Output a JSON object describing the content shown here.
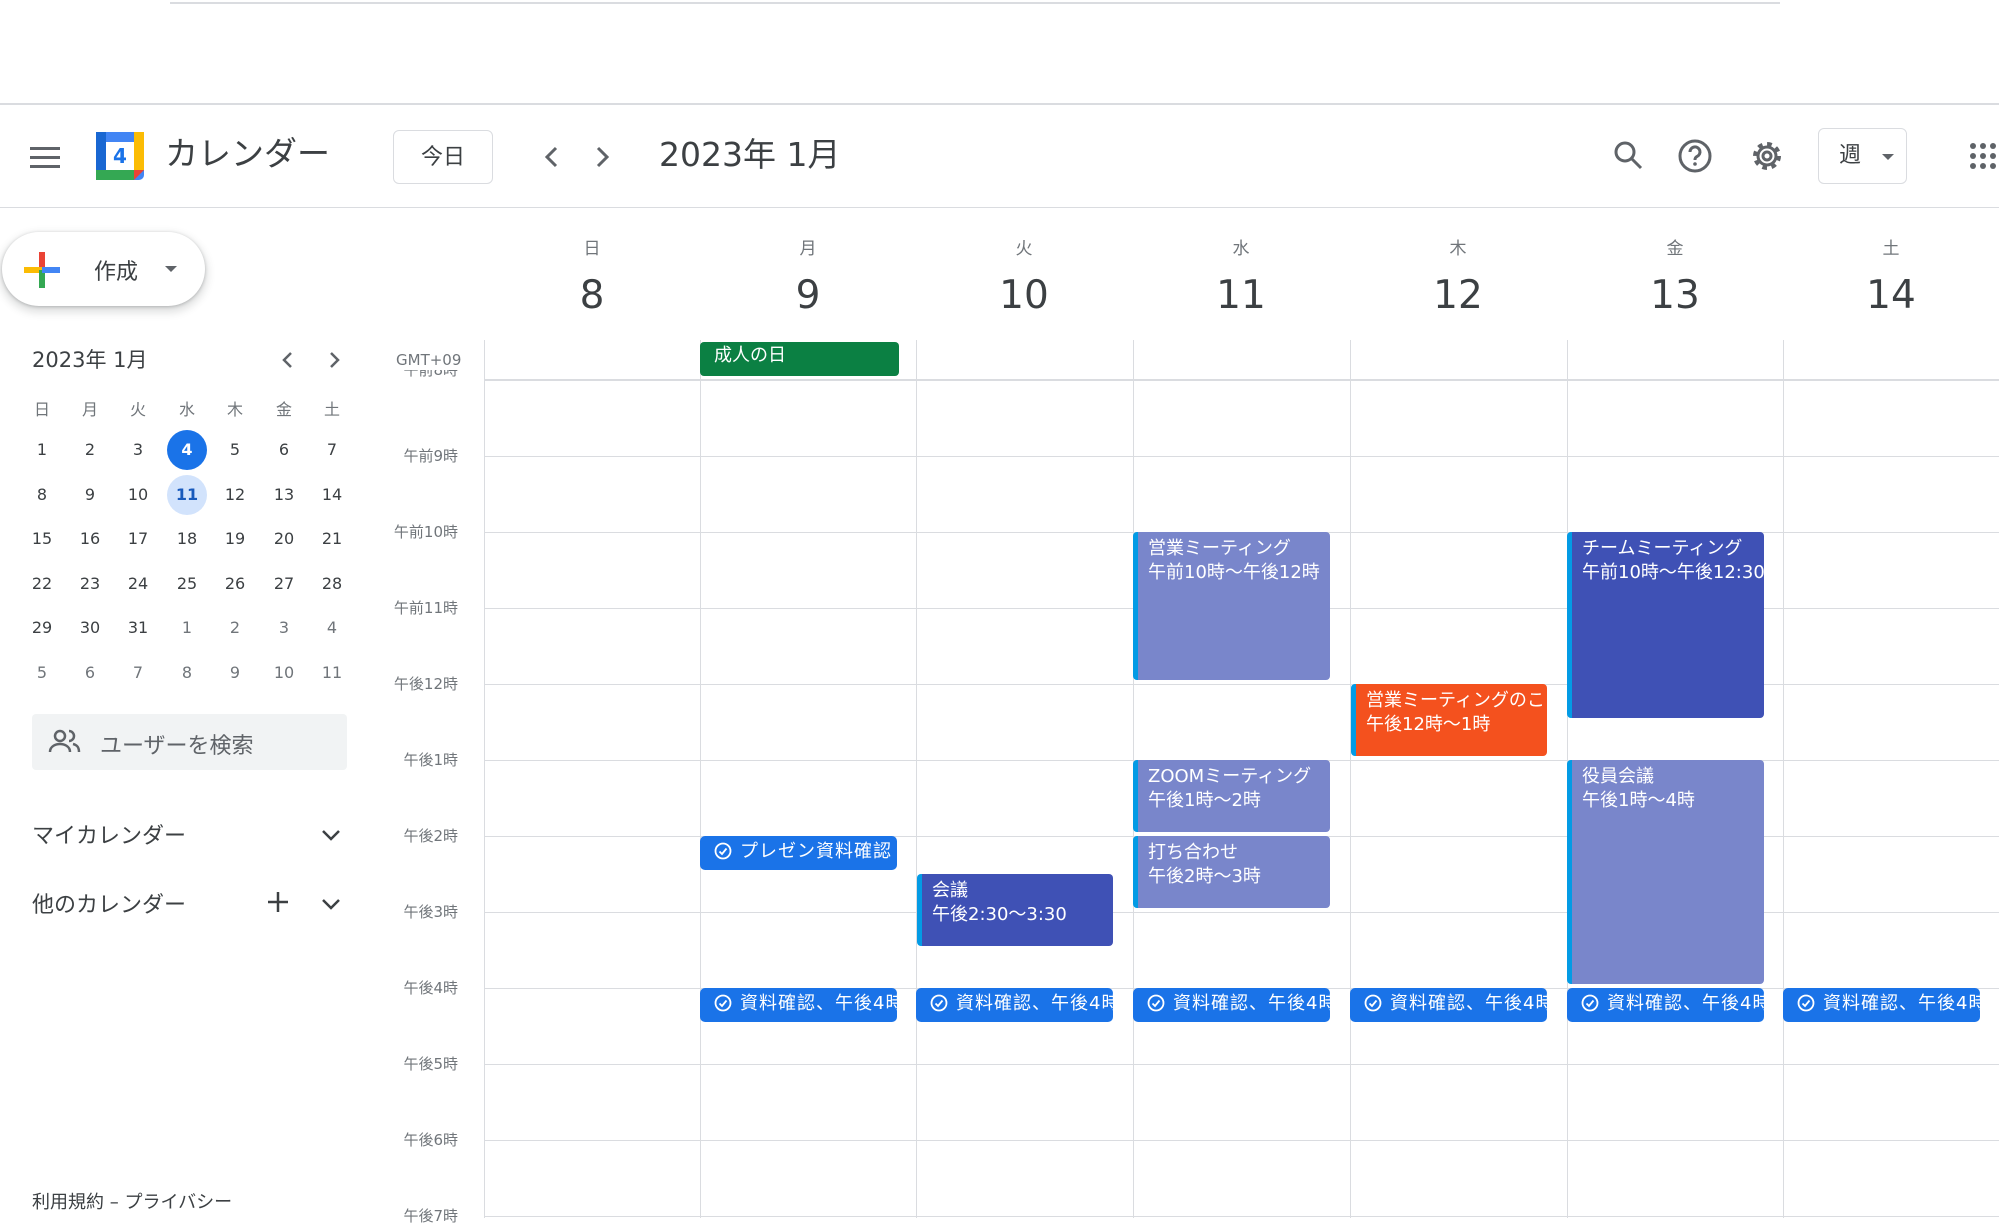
{
  "header": {
    "app_title": "カレンダー",
    "logo_day": "4",
    "today_label": "今日",
    "month_title": "2023年 1月",
    "view_label": "週"
  },
  "sidebar": {
    "create_label": "作成",
    "mini_calendar": {
      "title": "2023年 1月",
      "dow": [
        "日",
        "月",
        "火",
        "水",
        "木",
        "金",
        "土"
      ],
      "weeks": [
        [
          "1",
          "2",
          "3",
          "4",
          "5",
          "6",
          "7"
        ],
        [
          "8",
          "9",
          "10",
          "11",
          "12",
          "13",
          "14"
        ],
        [
          "15",
          "16",
          "17",
          "18",
          "19",
          "20",
          "21"
        ],
        [
          "22",
          "23",
          "24",
          "25",
          "26",
          "27",
          "28"
        ],
        [
          "29",
          "30",
          "31",
          "1",
          "2",
          "3",
          "4"
        ],
        [
          "5",
          "6",
          "7",
          "8",
          "9",
          "10",
          "11"
        ]
      ],
      "today": "4",
      "selected": "11"
    },
    "search_users": "ユーザーを検索",
    "my_calendars": "マイカレンダー",
    "other_calendars": "他のカレンダー",
    "footer": "利用規約 – プライバシー"
  },
  "grid": {
    "timezone": "GMT+09",
    "days": [
      {
        "dow": "日",
        "num": "8"
      },
      {
        "dow": "月",
        "num": "9"
      },
      {
        "dow": "火",
        "num": "10"
      },
      {
        "dow": "水",
        "num": "11"
      },
      {
        "dow": "木",
        "num": "12"
      },
      {
        "dow": "金",
        "num": "13"
      },
      {
        "dow": "土",
        "num": "14"
      }
    ],
    "hours": [
      "午前8時",
      "午前9時",
      "午前10時",
      "午前11時",
      "午後12時",
      "午後1時",
      "午後2時",
      "午後3時",
      "午後4時",
      "午後5時",
      "午後6時",
      "午後7時"
    ]
  },
  "events": {
    "holiday": "成人の日",
    "tue_meeting": {
      "title": "会議",
      "time": "午後2:30〜3:30"
    },
    "wed_sales": {
      "title": "営業ミーティング",
      "time": "午前10時〜午後12時"
    },
    "wed_zoom": {
      "title": "ZOOMミーティング",
      "time": "午後1時〜2時"
    },
    "wed_uchiawase": {
      "title": "打ち合わせ",
      "time": "午後2時〜3時"
    },
    "thu_sales": {
      "title": "営業ミーティングのこ",
      "time": "午後12時〜1時"
    },
    "fri_team": {
      "title": "チームミーティング",
      "time": "午前10時〜午後12:30"
    },
    "fri_board": {
      "title": "役員会議",
      "time": "午後1時〜4時"
    },
    "mon_task": "プレゼン資料確認",
    "daily_task": "資料確認、午後4時"
  }
}
